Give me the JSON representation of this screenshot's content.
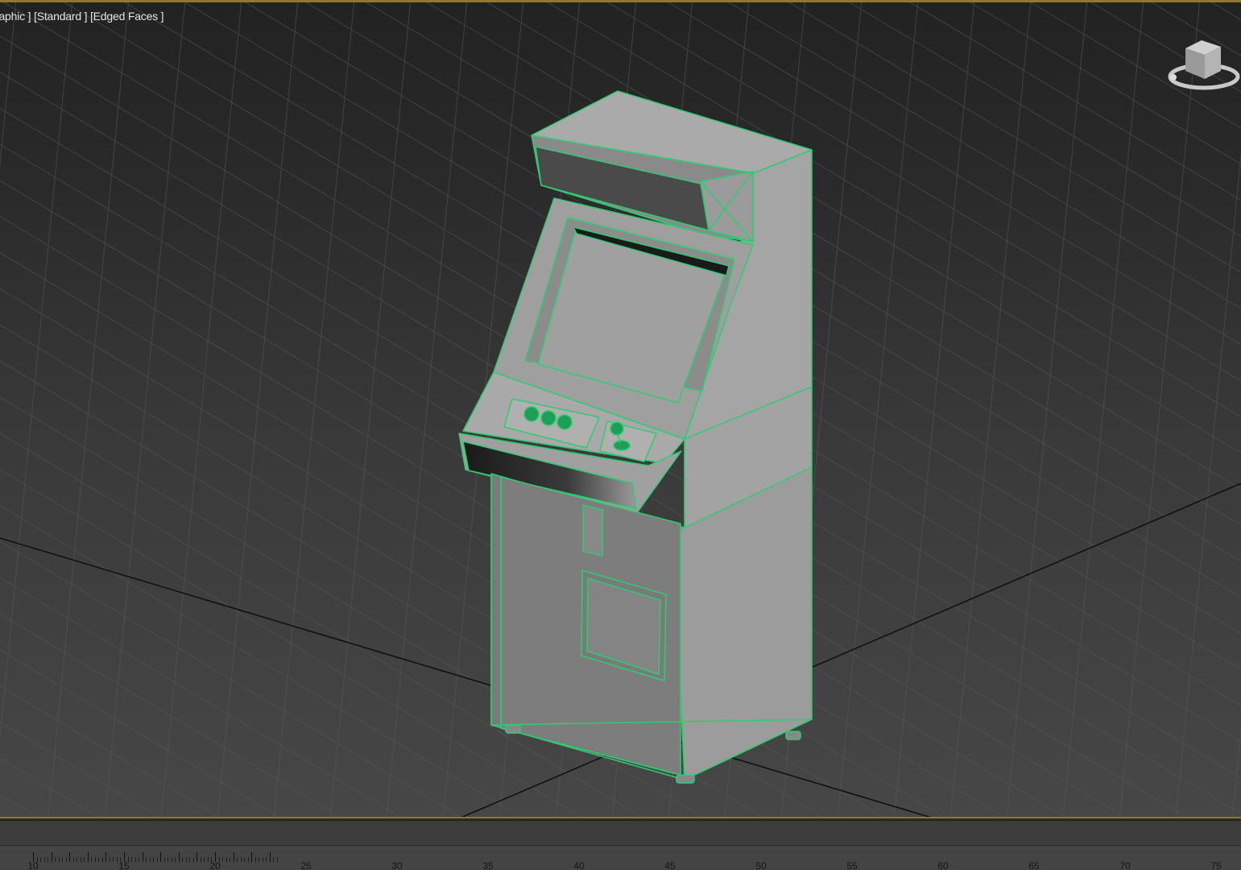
{
  "viewport": {
    "label": "raphic ] [Standard ] [Edged Faces ]"
  },
  "viewcube": {
    "icon": "viewcube-icon"
  },
  "model": {
    "name": "arcade-cabinet",
    "edge_color": "#2ecc71",
    "body_color": "#a2a2a2"
  },
  "timeline": {
    "ticks": [
      "10",
      "15",
      "20",
      "25",
      "30",
      "35",
      "40",
      "45",
      "50",
      "55",
      "60",
      "65",
      "70",
      "75"
    ]
  },
  "colors": {
    "frame_accent": "#8f7a2c",
    "edge_highlight": "#2ecc71"
  }
}
